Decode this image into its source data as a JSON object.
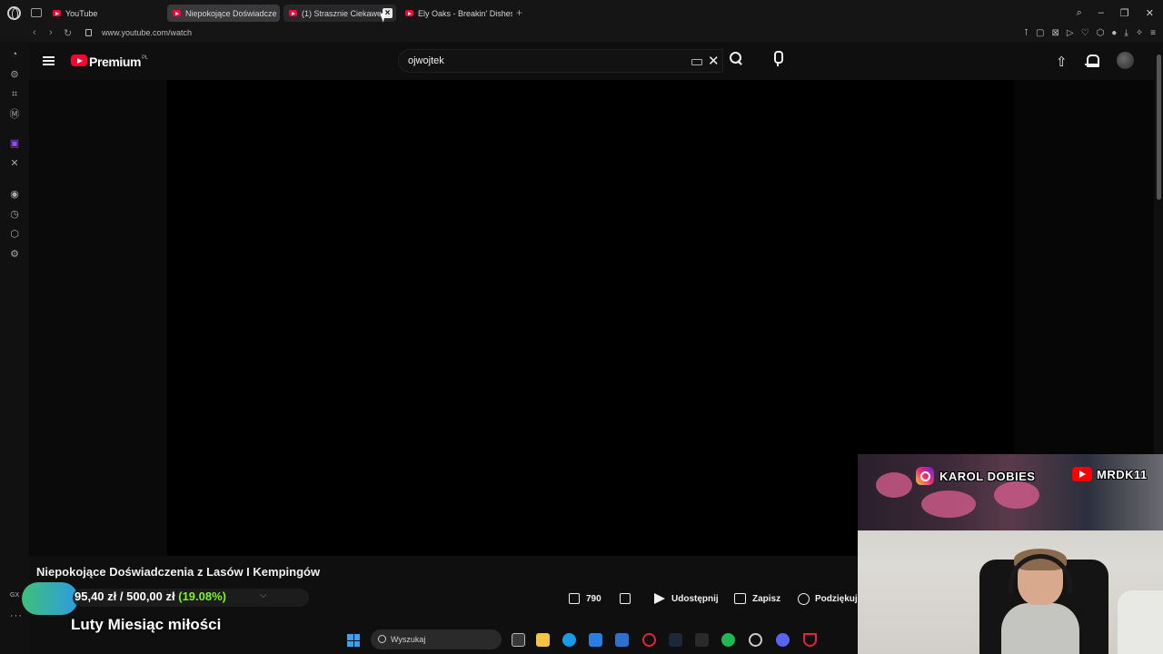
{
  "browser": {
    "tabs": [
      {
        "title": "YouTube",
        "state": "normal"
      },
      {
        "title": "Niepokojące Doświadcze",
        "state": "active"
      },
      {
        "title": "(1) Strasznie Ciekawe",
        "state": "hover"
      },
      {
        "title": "Ely Oaks - Breakin' Dishes",
        "state": "normal"
      }
    ],
    "new_tab_label": "+",
    "url": "www.youtube.com/watch"
  },
  "youtube": {
    "brand": "Premium",
    "region": "PL",
    "search_query": "ojwojtek",
    "video_title": "Niepokojące Doświadczenia z Lasów I Kempingów",
    "actions": {
      "like_count": "790",
      "share": "Udostępnij",
      "save": "Zapisz",
      "thanks": "Podziękuj"
    }
  },
  "overlay": {
    "gx_label": "GX",
    "donation_raised": "95,40 zł",
    "donation_goal": "500,00 zł",
    "donation_percent": "(19.08%)",
    "month_text": "Luty Miesiąc miłości",
    "instagram": "KAROL DOBIES",
    "youtube_channel": "MRDK11"
  },
  "taskbar": {
    "search_placeholder": "Wyszukaj"
  },
  "colors": {
    "yt_red": "#ff0033",
    "donation_green": "#7cf52b",
    "twitch": "#9146ff"
  }
}
